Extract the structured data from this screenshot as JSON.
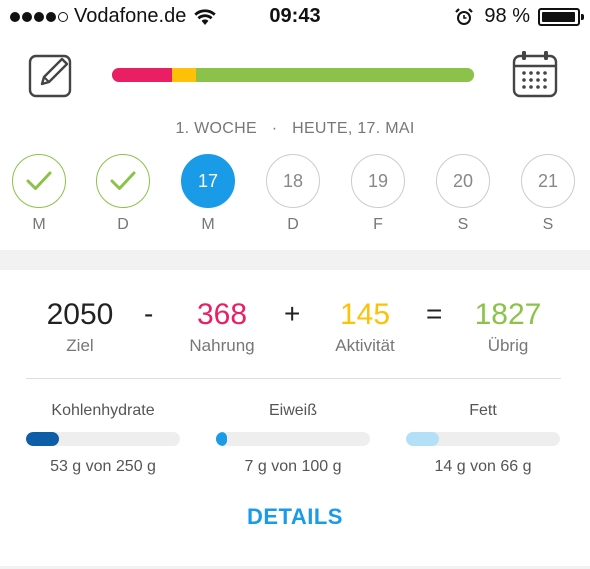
{
  "status_bar": {
    "carrier": "Vodafone.de",
    "signal_bars_filled": 4,
    "time": "09:43",
    "battery_percent_label": "98 %",
    "battery_level": 0.98,
    "icons": [
      "signal-dots-icon",
      "wifi-icon",
      "alarm-icon",
      "battery-icon"
    ]
  },
  "header": {
    "edit_icon": "edit-note-icon",
    "calendar_icon": "calendar-icon",
    "calorie_bar": {
      "segments": [
        {
          "name": "nahrung",
          "fraction": 0.165,
          "color": "#e91e63"
        },
        {
          "name": "mid",
          "fraction": 0.068,
          "color": "#ffc107"
        },
        {
          "name": "rest",
          "fraction": 0.767,
          "color": "#8bc34a"
        }
      ]
    },
    "week_label": "1. WOCHE",
    "separator": "·",
    "today_label": "HEUTE, 17. MAI"
  },
  "days": [
    {
      "letter": "M",
      "state": "done",
      "date": ""
    },
    {
      "letter": "D",
      "state": "done",
      "date": ""
    },
    {
      "letter": "M",
      "state": "today",
      "date": "17"
    },
    {
      "letter": "D",
      "state": "future",
      "date": "18"
    },
    {
      "letter": "F",
      "state": "future",
      "date": "19"
    },
    {
      "letter": "S",
      "state": "future",
      "date": "20"
    },
    {
      "letter": "S",
      "state": "future",
      "date": "21"
    }
  ],
  "summary": {
    "goal": {
      "value": "2050",
      "label": "Ziel",
      "color": "#222222"
    },
    "op_minus": "-",
    "food": {
      "value": "368",
      "label": "Nahrung",
      "color": "#e91e63"
    },
    "op_plus": "+",
    "activity": {
      "value": "145",
      "label": "Aktivität",
      "color": "#ffc107"
    },
    "op_equals": "=",
    "remaining": {
      "value": "1827",
      "label": "Übrig",
      "color": "#8bc34a"
    }
  },
  "macros": [
    {
      "title": "Kohlenhydrate",
      "value": "53 g von 250 g",
      "fraction": 0.212,
      "color": "#0d5ea6"
    },
    {
      "title": "Eiweiß",
      "value": "7 g von 100 g",
      "fraction": 0.07,
      "color": "#1a9be8"
    },
    {
      "title": "Fett",
      "value": "14 g von 66 g",
      "fraction": 0.212,
      "color": "#b3e0f7"
    }
  ],
  "details_label": "DETAILS"
}
